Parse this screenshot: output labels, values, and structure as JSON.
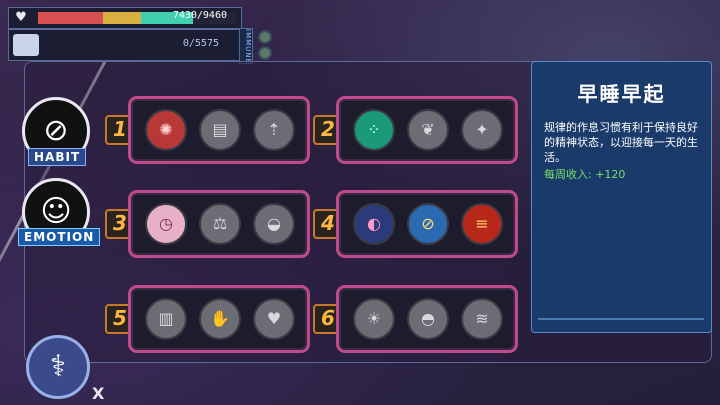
{
  "hud": {
    "hp_text": "7430/9460",
    "hp_fraction": 0.785,
    "ep_text": "0/5575",
    "immune_label": "IMMUNE",
    "colors": {
      "hp_red": "#d95050",
      "hp_yellow": "#d8b040",
      "hp_teal": "#40d0b0"
    }
  },
  "categories": [
    {
      "label": "HABIT",
      "icon": "no-smoking-icon"
    },
    {
      "label": "EMOTION",
      "icon": "face-icon",
      "active": true
    }
  ],
  "cards": [
    {
      "number": "1",
      "slots": [
        "virus-icon",
        "books-icon",
        "growth-icon"
      ]
    },
    {
      "number": "2",
      "slots": [
        "dots-icon",
        "brain-icon",
        "insect-icon"
      ]
    },
    {
      "number": "3",
      "slots": [
        "clock-icon",
        "scale-icon",
        "muscle-icon"
      ]
    },
    {
      "number": "4",
      "slots": [
        "mouth-icon",
        "no-drink-icon",
        "burger-icon"
      ]
    },
    {
      "number": "5",
      "slots": [
        "bin-icon",
        "glove-icon",
        "heart-icon"
      ]
    },
    {
      "number": "6",
      "slots": [
        "person-icon",
        "sunrise-icon",
        "steam-icon"
      ]
    }
  ],
  "info": {
    "title": "早睡早起",
    "body": "规律的作息习惯有利于保持良好的精神状态，以迎接每一天的生活。",
    "income": "每周收入: +120"
  },
  "close_label": "X"
}
